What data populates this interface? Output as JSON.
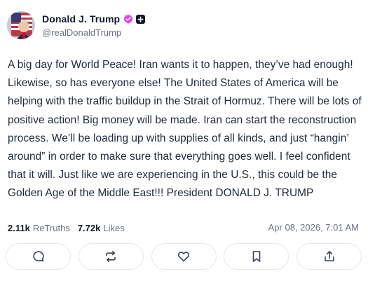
{
  "author": {
    "display_name": "Donald J. Trump",
    "handle": "@realDonaldTrump",
    "avatar_icon": "avatar-flag-portrait",
    "verified_icon": "verified-badge-icon",
    "verified_color": "#d946ef",
    "extra_icon": "plus-square-icon"
  },
  "post": {
    "text": "A big day for World Peace! Iran wants it to happen, they’ve had enough! Likewise, so has everyone else! The United States of America will be helping with the traffic buildup in the Strait of Hormuz. There will be lots of positive action! Big money will be made. Iran can start the reconstruction process. We’ll be loading up with supplies of all kinds, and just “hangin’ around” in order to make sure that everything goes well. I feel confident that it will. Just like we are experiencing in the U.S., this could be the Golden Age of the Middle East!!! President DONALD J. TRUMP"
  },
  "stats": {
    "retruths_count": "2.11k",
    "retruths_label": "ReTruths",
    "likes_count": "7.72k",
    "likes_label": "Likes",
    "timestamp": "Apr 08, 2026, 7:01 AM"
  },
  "actions": [
    {
      "icon": "reply-icon"
    },
    {
      "icon": "retruth-icon"
    },
    {
      "icon": "like-icon"
    },
    {
      "icon": "bookmark-icon"
    },
    {
      "icon": "share-icon"
    }
  ],
  "colors": {
    "text": "#1f2937",
    "muted": "#6b7280",
    "border": "#e5e7eb"
  }
}
